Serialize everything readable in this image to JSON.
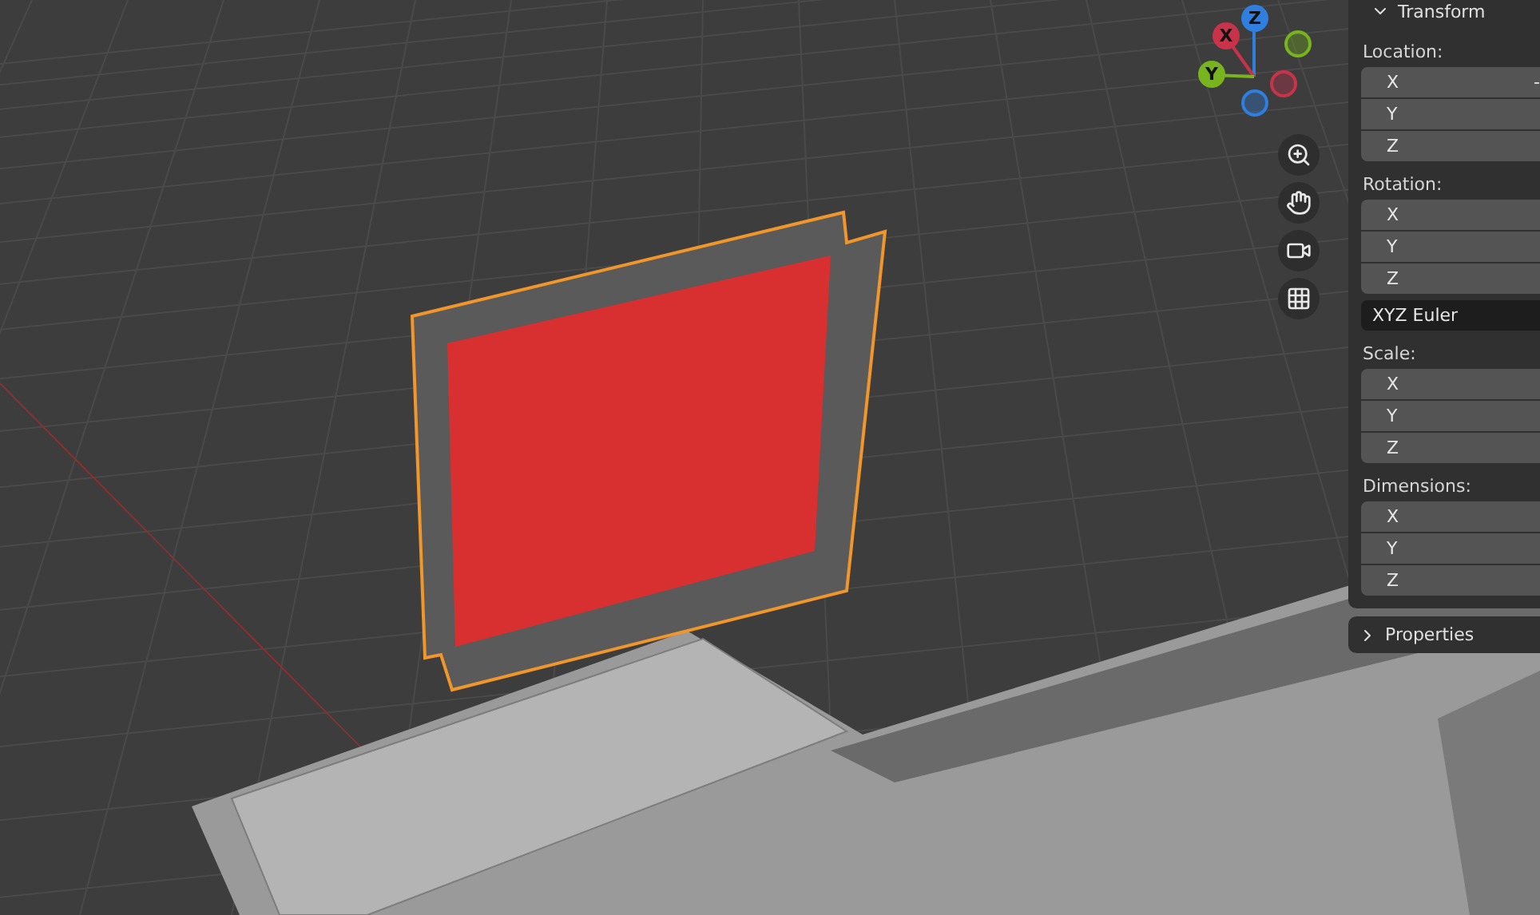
{
  "gizmo": {
    "axes": [
      {
        "label": "Z",
        "color": "#2f7fe0"
      },
      {
        "label": "X",
        "color": "#c8334a"
      },
      {
        "label": "Y",
        "color": "#78b41e"
      }
    ]
  },
  "transform": {
    "title": "Transform",
    "expanded": true
  },
  "groups": [
    {
      "label": "Location:",
      "fields": [
        {
          "axis": "X",
          "value": "-"
        },
        {
          "axis": "Y"
        },
        {
          "axis": "Z"
        }
      ]
    },
    {
      "label": "Rotation:",
      "fields": [
        {
          "axis": "X"
        },
        {
          "axis": "Y"
        },
        {
          "axis": "Z"
        }
      ],
      "mode": "XYZ Euler"
    },
    {
      "label": "Scale:",
      "fields": [
        {
          "axis": "X"
        },
        {
          "axis": "Y"
        },
        {
          "axis": "Z"
        }
      ]
    },
    {
      "label": "Dimensions:",
      "fields": [
        {
          "axis": "X"
        },
        {
          "axis": "Y"
        },
        {
          "axis": "Z"
        }
      ]
    }
  ],
  "properties": {
    "title": "Properties",
    "expanded": false
  }
}
